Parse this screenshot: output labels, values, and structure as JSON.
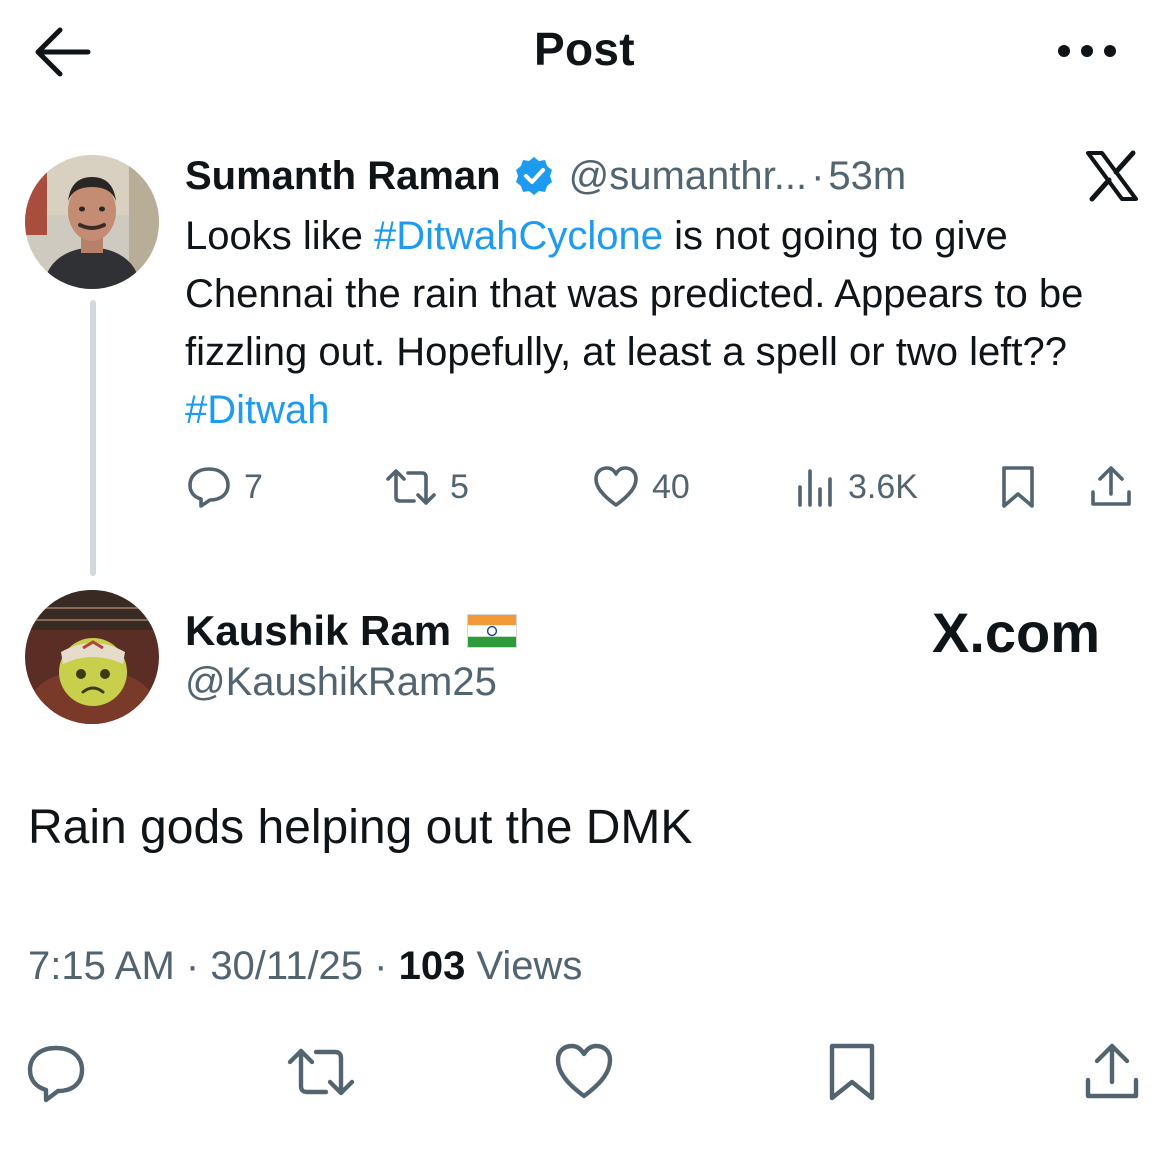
{
  "header": {
    "title": "Post",
    "back_icon": "arrow-left-icon",
    "more_icon": "more-dots-icon"
  },
  "quoted_tweet": {
    "author_name": "Sumanth Raman",
    "handle": "@sumanthr...",
    "separator": "·",
    "time": "53m",
    "body_parts": {
      "p1": "Looks like ",
      "tag1": "#DitwahCyclone",
      "p2": " is not going to give Chennai the rain that was predicted. Appears to be fizzling out. Hopefully, at least a spell or two left?? ",
      "tag2": "#Ditwah"
    },
    "actions": {
      "replies": "7",
      "reposts": "5",
      "likes": "40",
      "views": "3.6K"
    }
  },
  "reply_tweet": {
    "author_name": "Kaushik Ram",
    "handle": "@KaushikRam25",
    "watermark": "X.com",
    "body": "Rain gods helping out the DMK",
    "time": "7:15 AM",
    "sep1": " · ",
    "date": "30/11/25",
    "sep2": " · ",
    "views_count": "103",
    "views_label": " Views"
  },
  "colors": {
    "text": "#0f1419",
    "secondary": "#536471",
    "link": "#1d9bf0",
    "thread_line": "#cfd9de"
  }
}
